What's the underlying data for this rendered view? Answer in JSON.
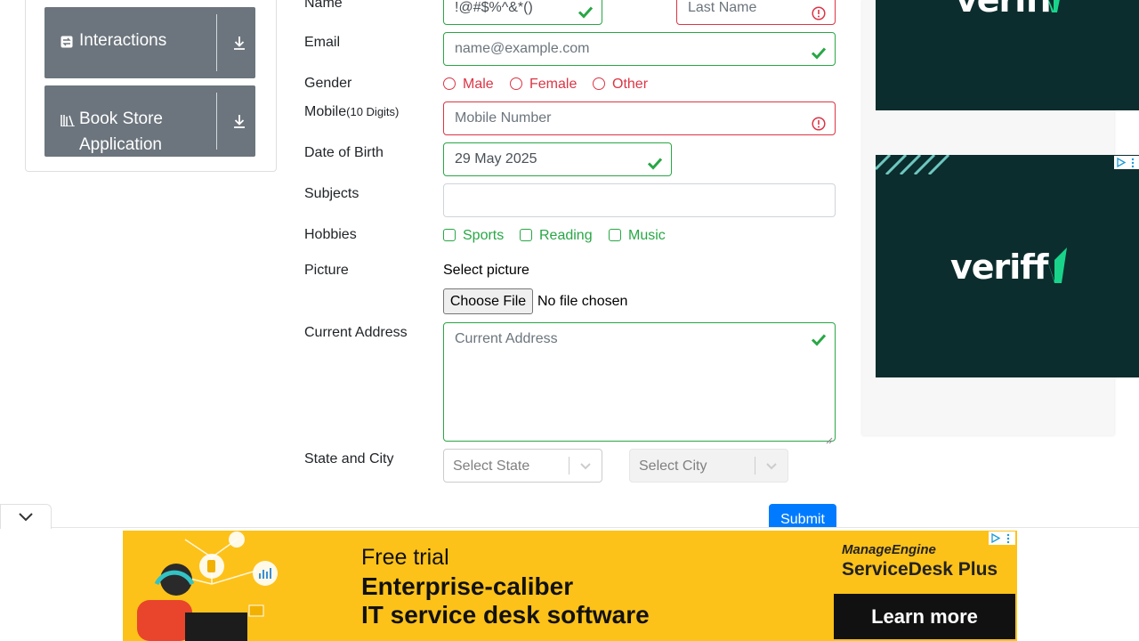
{
  "sidebar": {
    "groups": [
      {
        "label": "Interactions",
        "icon": "swap-icon"
      },
      {
        "label_line1": "Book Store",
        "label_line2": "Application",
        "icon": "books-icon"
      }
    ]
  },
  "form": {
    "name_label": "Name",
    "first_name_value": "!@#$%^&*()",
    "last_name_placeholder": "Last Name",
    "email_label": "Email",
    "email_placeholder": "name@example.com",
    "gender_label": "Gender",
    "gender_options": [
      "Male",
      "Female",
      "Other"
    ],
    "mobile_label": "Mobile",
    "mobile_hint": "(10 Digits)",
    "mobile_placeholder": "Mobile Number",
    "dob_label": "Date of Birth",
    "dob_value": "29 May 2025",
    "subjects_label": "Subjects",
    "hobbies_label": "Hobbies",
    "hobbies_options": [
      "Sports",
      "Reading",
      "Music"
    ],
    "picture_label": "Picture",
    "picture_caption": "Select picture",
    "file_button": "Choose File",
    "file_status": "No file chosen",
    "address_label": "Current Address",
    "address_placeholder": "Current Address",
    "state_city_label": "State and City",
    "state_placeholder": "Select State",
    "city_placeholder": "Select City",
    "submit_label": "Submit"
  },
  "ads": {
    "right_brand_top": "veriff",
    "right_brand": "veriff",
    "banner_line1": "Free trial",
    "banner_line2": "Enterprise-caliber",
    "banner_line3": "IT service desk software",
    "banner_brand1": "ManageEngine",
    "banner_brand2": "ServiceDesk Plus",
    "banner_cta": "Learn more"
  },
  "colors": {
    "valid": "#28a745",
    "invalid": "#dc3545",
    "primary": "#007bff",
    "sidebar_group": "#6c757d",
    "veriff_bg": "#0c2d2d",
    "banner_bg": "#fdc219"
  }
}
